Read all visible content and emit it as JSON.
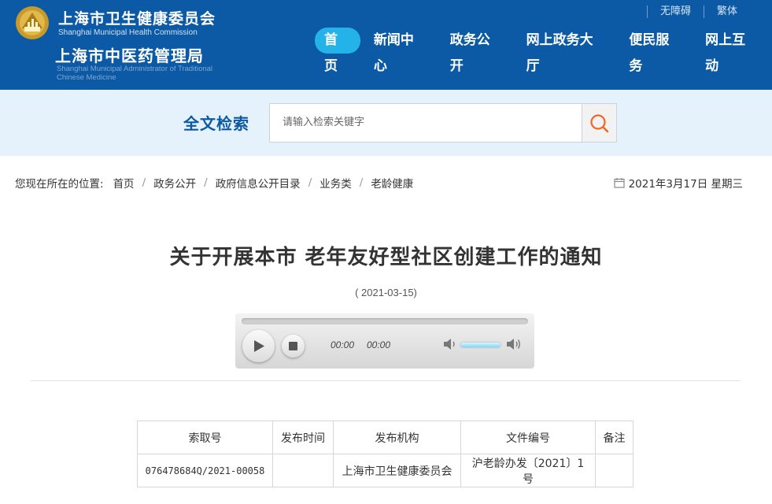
{
  "header": {
    "org_name": "上海市卫生健康委员会",
    "org_name_en": "Shanghai Municipal Health Commission",
    "org_name2": "上海市中医药管理局",
    "org_name2_en": "Shanghai Municipal Administrator of Traditional Chinese Medicine",
    "top_links": [
      "无障碍",
      "繁体"
    ],
    "nav": [
      "首页",
      "新闻中心",
      "政务公开",
      "网上政务大厅",
      "便民服务",
      "网上互动"
    ],
    "active_nav": "首页"
  },
  "search": {
    "title": "全文检索",
    "placeholder": "请输入检索关键字",
    "button_icon": "search-icon"
  },
  "breadcrumb": {
    "prefix": "您现在所在的位置:",
    "items": [
      "首页",
      "政务公开",
      "政府信息公开目录",
      "业务类",
      "老龄健康"
    ]
  },
  "date": {
    "text": "2021年3月17日 星期三",
    "icon": "calendar-icon"
  },
  "article": {
    "title": "关于开展本市 老年友好型社区创建工作的通知",
    "pubdate": "( 2021-03-15)"
  },
  "player": {
    "current_time": "00:00",
    "duration": "00:00",
    "volume": 1.0
  },
  "info_table": {
    "headers": [
      "索取号",
      "发布时间",
      "发布机构",
      "文件编号",
      "备注"
    ],
    "rows": [
      [
        "076478684Q/2021-00058",
        "",
        "上海市卫生健康委员会",
        "沪老龄办发〔2021〕1号",
        ""
      ]
    ]
  },
  "colors": {
    "header_bg": "#0c5aa6",
    "nav_active": "#23b3e8",
    "search_band": "#e5f1fb",
    "search_icon": "#f26522"
  }
}
